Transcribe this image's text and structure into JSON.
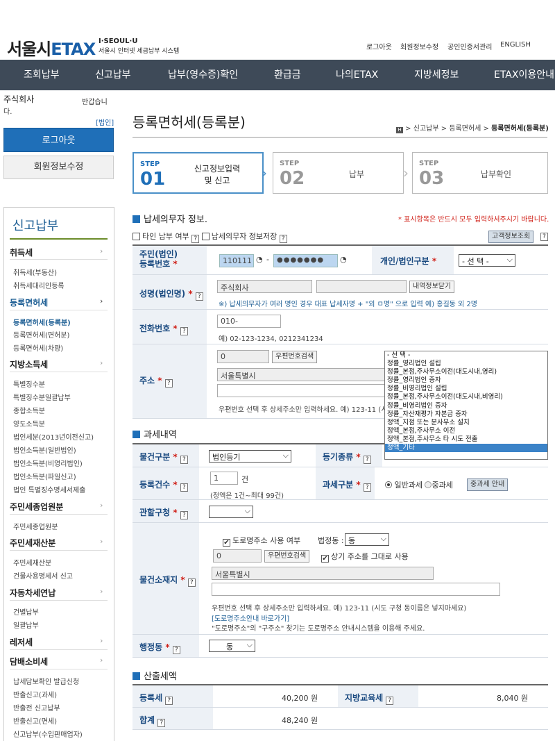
{
  "header": {
    "logo_main": "서울시",
    "logo_etax": "ETAX",
    "logo_sub1": "I·SEOUL·U",
    "logo_sub2": "서울시 인터넷 세금납부 시스템",
    "util_links": [
      "로그아웃",
      "회원정보수정",
      "공인인증서관리",
      "ENGLISH"
    ]
  },
  "nav": [
    "조회납부",
    "신고납부",
    "납부(영수증)확인",
    "환급금",
    "나의ETAX",
    "지방세정보",
    "ETAX이용안내"
  ],
  "sidebar": {
    "user_name": "주식회사",
    "greeting_1": "반갑습니",
    "greeting_2": "다.",
    "user_type": "[법인]",
    "logout": "로그아웃",
    "edit_profile": "회원정보수정",
    "title": "신고납부",
    "categories": [
      {
        "label": "취득세",
        "subs": [
          "취득세(부동산)",
          "취득세대리인등록"
        ]
      },
      {
        "label": "등록면허세",
        "subs": [
          "등록면허세(등록분)",
          "등록면허세(면허분)",
          "등록면허세(차량)"
        ]
      },
      {
        "label": "지방소득세",
        "subs": [
          "특별징수분",
          "특별징수분일괄납부",
          "종합소득분",
          "양도소득분",
          "법인세분(2013년이전신고)",
          "법인소득분(일반법인)",
          "법인소득분(비영리법인)",
          "법인소득분(파일신고)",
          "법인 특별징수명세서제출"
        ]
      },
      {
        "label": "주민세종업원분",
        "subs": [
          "주민세종업원분"
        ]
      },
      {
        "label": "주민세재산분",
        "subs": [
          "주민세재산분",
          "건물사용명세서 신고"
        ]
      },
      {
        "label": "자동차세연납",
        "subs": [
          "건별납부",
          "일괄납부"
        ]
      },
      {
        "label": "레저세",
        "subs": []
      },
      {
        "label": "담배소비세",
        "subs": [
          "납세담보확인 발급신청",
          "반출신고(과세)",
          "반출전 신고납부",
          "반출신고(면세)",
          "신고납부(수입판매업자)"
        ]
      }
    ]
  },
  "page": {
    "title_main": "등록면허세",
    "title_paren": "(등록분)",
    "breadcrumb": [
      "신고납부",
      "등록면허세",
      "등록면허세(등록분)"
    ]
  },
  "steps": [
    {
      "label": "STEP",
      "num": "01",
      "name_1": "신고정보입력",
      "name_2": "및 신고"
    },
    {
      "label": "STEP",
      "num": "02",
      "name_1": "납부"
    },
    {
      "label": "STEP",
      "num": "03",
      "name_1": "납부확인"
    }
  ],
  "taxpayer": {
    "section_title": "납세의무자 정보.",
    "required_notice": "* 표시항목은 반드시 모두 입력하셔주시기 바랍니다.",
    "other_pay_label": "타인 납부 여부",
    "save_info_label": "납세의무자 정보저장",
    "customer_lookup": "고객정보조회",
    "reg_no_label_1": "주민(법인)",
    "reg_no_label_2": "등록번호",
    "reg_no_front": "110111",
    "reg_no_back": "●●●●●●●",
    "type_label": "개인/법인구분",
    "type_value": "- 선 택 -",
    "name_label": "성명(법인명)",
    "name_value": "주식회사",
    "close_detail": "내역정보닫기",
    "name_note": "※) 납세의무자가 여러 명인 경우 대표 납세자명 + \"외 ㅁ명\" 으로 입력 예) 홍길동 외 2명",
    "phone_label": "전화번호",
    "phone_value": "010-",
    "phone_note": "예) 02-123-1234, 0212341234",
    "address_label": "주소",
    "zip_value": "0",
    "zip_search": "우편번호검색",
    "address_value": "서울특별시",
    "address_note": "우편번호 선택 후 상세주소만 입력하세요. 예) 123-11 (시도"
  },
  "dropdown_options": [
    "- 선 택 -",
    "정률_영리법인 설립",
    "정률_본점,주사무소이전(대도시내,영리)",
    "정률_영리법인 증자",
    "정률_비영리법인 설립",
    "정률_본점,주사무소이전(대도시내,비영리)",
    "정률_비영리법인 증자",
    "정률_자산재평가 자본금 증자",
    "정액_지점 또는 분사무소 설치",
    "정액_본점,주사무소 이전",
    "정액_본점,주사무소 타 시도 전출",
    "정액_기타"
  ],
  "taxation": {
    "section_title": "과세내역",
    "item_type_label": "물건구분",
    "item_type_value": "법인등기",
    "reg_type_label": "등기종류",
    "count_label": "등록건수",
    "count_value": "1",
    "count_unit": "건",
    "count_note": "(정액은 1건~최대 99건)",
    "tax_type_label": "과세구분",
    "tax_general": "일반과세",
    "tax_heavy": "중과세",
    "heavy_guide": "중과세 안내",
    "office_label": "관할구청",
    "location_label": "물건소재지",
    "road_addr_label": "도로명주소 사용 여부",
    "legal_dong_label": "법정동 :",
    "legal_dong_value": "동",
    "loc_zip_value": "0",
    "loc_zip_search": "우편번호검색",
    "same_addr_label": "상기 주소를 그대로 사용",
    "loc_addr_value": "서울특별시",
    "loc_note_1": "우편번호 선택 후 상세주소만 입력하세요. 예) 123-11 (시도 구청 동이름은 넣지마세요)",
    "loc_note_2": "[도로명주소안내 바로가기]",
    "loc_note_3": "\"도로명주소\"의 \"구주소\" 찾기는 도로명주소 안내시스템을 이용해 주세요.",
    "admin_dong_label": "행정동",
    "admin_dong_value": "동"
  },
  "calc": {
    "section_title": "산출세액",
    "reg_tax_label": "등록세",
    "reg_tax_value": "40,200 원",
    "edu_tax_label": "지방교육세",
    "edu_tax_value": "8,040 원",
    "total_label": "합계",
    "total_value": "48,240 원"
  }
}
